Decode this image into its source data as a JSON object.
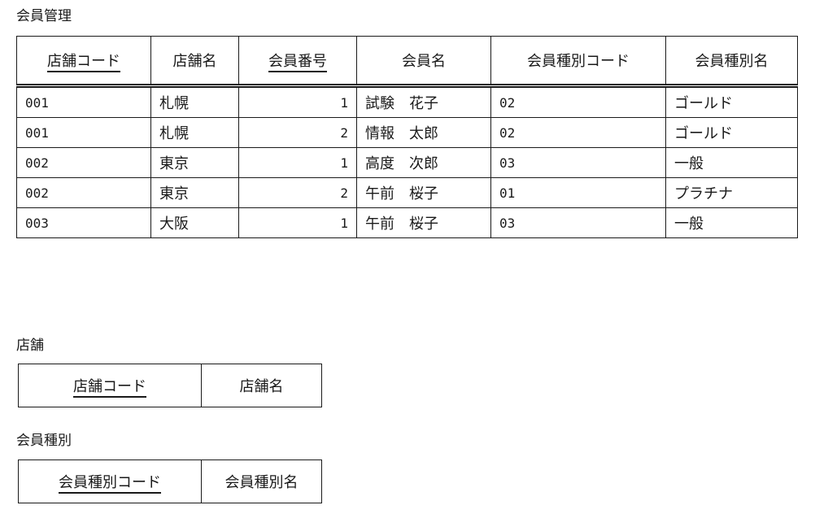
{
  "main_table": {
    "caption": "会員管理",
    "headers": [
      "店舗コード",
      "店舗名",
      "会員番号",
      "会員名",
      "会員種別コード",
      "会員種別名"
    ],
    "rows": [
      [
        "001",
        "札幌",
        "1",
        "試験　花子",
        "02",
        "ゴールド"
      ],
      [
        "001",
        "札幌",
        "2",
        "情報　太郎",
        "02",
        "ゴールド"
      ],
      [
        "002",
        "東京",
        "1",
        "高度　次郎",
        "03",
        "一般"
      ],
      [
        "002",
        "東京",
        "2",
        "午前　桜子",
        "01",
        "プラチナ"
      ],
      [
        "003",
        "大阪",
        "1",
        "午前　桜子",
        "03",
        "一般"
      ]
    ]
  },
  "store_table": {
    "caption": "店舗",
    "headers": [
      "店舗コード",
      "店舗名"
    ]
  },
  "member_type_table": {
    "caption": "会員種別",
    "headers": [
      "会員種別コード",
      "会員種別名"
    ]
  }
}
